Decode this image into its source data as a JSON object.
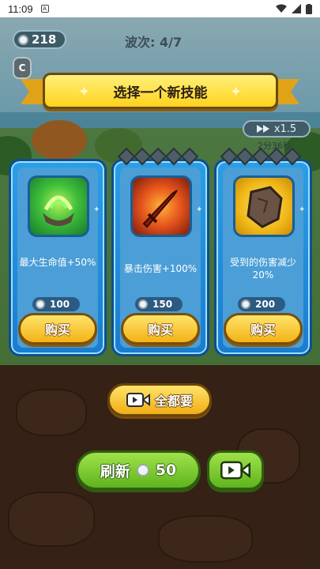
{
  "status_bar": {
    "time": "11:09",
    "app_badge": "A"
  },
  "hud": {
    "coins": "218",
    "wave": "波次: 4/7",
    "speed": "x1.5",
    "timer": "2分36秒"
  },
  "banner": {
    "title": "选择一个新技能"
  },
  "cards": [
    {
      "name": "最大生命值+50%",
      "price": "100",
      "buy_label": "购买",
      "icon": "green-cauldron-icon",
      "color": "#37b44a"
    },
    {
      "name": "暴击伤害+100%",
      "price": "150",
      "buy_label": "购买",
      "icon": "flaming-sword-icon",
      "color": "#d8431a"
    },
    {
      "name": "受到的伤害减少20%",
      "price": "200",
      "buy_label": "购买",
      "icon": "rock-shield-icon",
      "color": "#f0b818"
    }
  ],
  "actions": {
    "take_all_label": "全都要",
    "refresh_label": "刷新",
    "refresh_price": "50"
  }
}
